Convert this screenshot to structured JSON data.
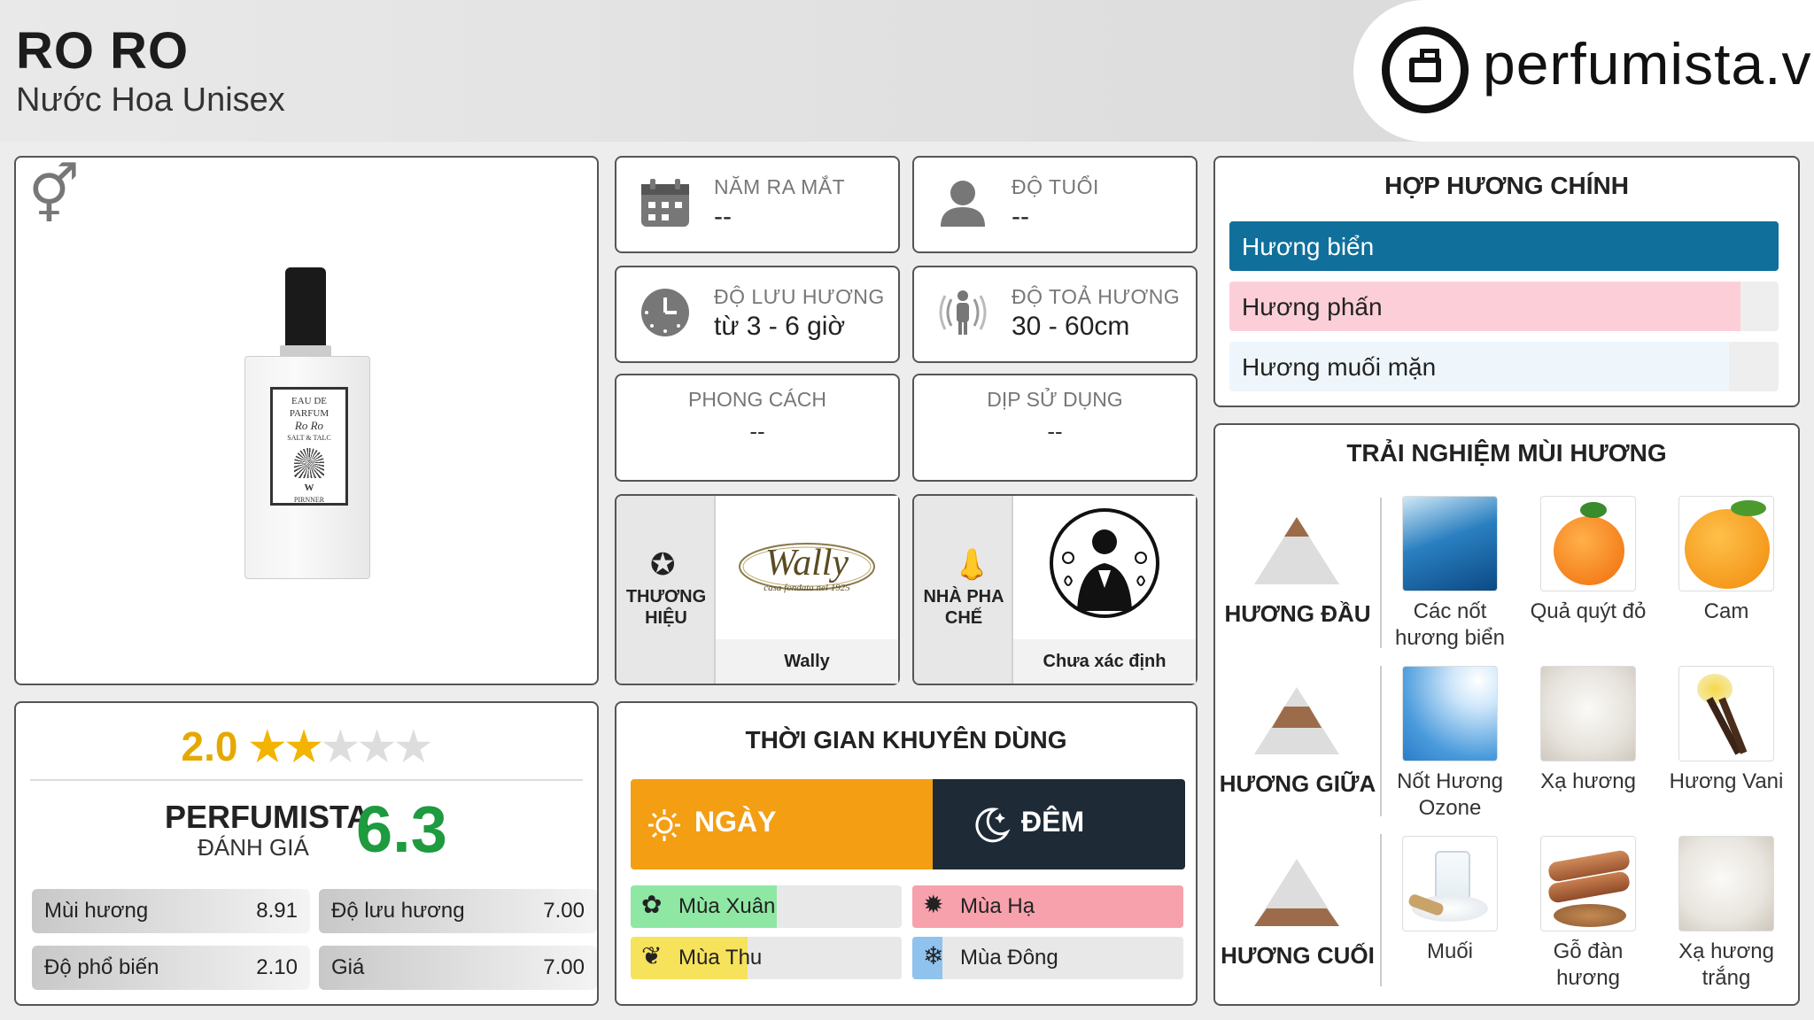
{
  "header": {
    "title": "RO RO",
    "subtitle": "Nước Hoa Unisex",
    "logo_text": "perfumista.vn"
  },
  "product": {
    "gender_icon": "unisex-gender-icon",
    "bottle_label": [
      "EAU DE PARFUM",
      "Ro Ro",
      "SALT & TALC",
      "W",
      "PIRNNER"
    ]
  },
  "rating": {
    "score": "2.0",
    "stars_filled": 2,
    "stars_total": 5,
    "brand": "PERFUMISTA",
    "brand_sub": "ĐÁNH GIÁ",
    "perfumista_score": "6.3",
    "metrics": [
      {
        "label": "Mùi hương",
        "value": "8.91"
      },
      {
        "label": "Độ lưu hương",
        "value": "7.00"
      },
      {
        "label": "Độ phổ biến",
        "value": "2.10"
      },
      {
        "label": "Giá",
        "value": "7.00"
      }
    ]
  },
  "info": {
    "year": {
      "label": "NĂM RA MẮT",
      "value": "--",
      "icon": "calendar-icon"
    },
    "age": {
      "label": "ĐỘ TUỔI",
      "value": "--",
      "icon": "person-icon"
    },
    "longevity": {
      "label": "ĐỘ LƯU HƯƠNG",
      "value": "từ 3 - 6 giờ",
      "icon": "clock-icon"
    },
    "sillage": {
      "label": "ĐỘ TOẢ HƯƠNG",
      "value": "30 - 60cm",
      "icon": "radiate-person-icon"
    },
    "style": {
      "label": "PHONG CÁCH",
      "value": "--"
    },
    "occasion": {
      "label": "DỊP SỬ DỤNG",
      "value": "--"
    },
    "brand": {
      "label": "THƯƠNG HIỆU",
      "name": "Wally",
      "logo_text": "Wally",
      "logo_sub": "casa fondata nel 1925",
      "icon": "star-circle-icon"
    },
    "perfumer": {
      "label": "NHÀ PHA CHẾ",
      "name": "Chưa xác định",
      "icon": "nose-icon"
    }
  },
  "recommended_time": {
    "title": "THỜI GIAN KHUYÊN DÙNG",
    "day_label": "NGÀY",
    "night_label": "ĐÊM",
    "day_fraction": 0.545,
    "seasons": [
      {
        "label": "Mùa Xuân",
        "fraction": 0.54,
        "color": "#8ee7a3",
        "icon": "flower-icon"
      },
      {
        "label": "Mùa Hạ",
        "fraction": 1.0,
        "color": "#f7a1ad",
        "icon": "sun-icon"
      },
      {
        "label": "Mùa Thu",
        "fraction": 0.43,
        "color": "#f7e25c",
        "icon": "leaf-icon"
      },
      {
        "label": "Mùa Đông",
        "fraction": 0.11,
        "color": "#8fc3ee",
        "icon": "snowflake-icon"
      }
    ]
  },
  "main_accords": {
    "title": "HỢP HƯƠNG CHÍNH",
    "items": [
      {
        "label": "Hương biển",
        "fraction": 1.0,
        "color": "#10709b",
        "text_color": "#ffffff"
      },
      {
        "label": "Hương phấn",
        "fraction": 0.93,
        "color": "#fccfd8",
        "text_color": "#222222"
      },
      {
        "label": "Hương muối mặn",
        "fraction": 0.91,
        "color": "#eef6fc",
        "text_color": "#222222"
      }
    ]
  },
  "notes": {
    "title": "TRẢI NGHIỆM MÙI HƯƠNG",
    "tiers": [
      {
        "label": "HƯƠNG ĐẦU",
        "items": [
          "Các nốt hương biển",
          "Quả quýt đỏ",
          "Cam"
        ]
      },
      {
        "label": "HƯƠNG GIỮA",
        "items": [
          "Nốt Hương Ozone",
          "Xạ hương",
          "Hương Vani"
        ]
      },
      {
        "label": "HƯƠNG CUỐI",
        "items": [
          "Muối",
          "Gỗ đàn hương",
          "Xạ hương trắng"
        ]
      }
    ]
  }
}
